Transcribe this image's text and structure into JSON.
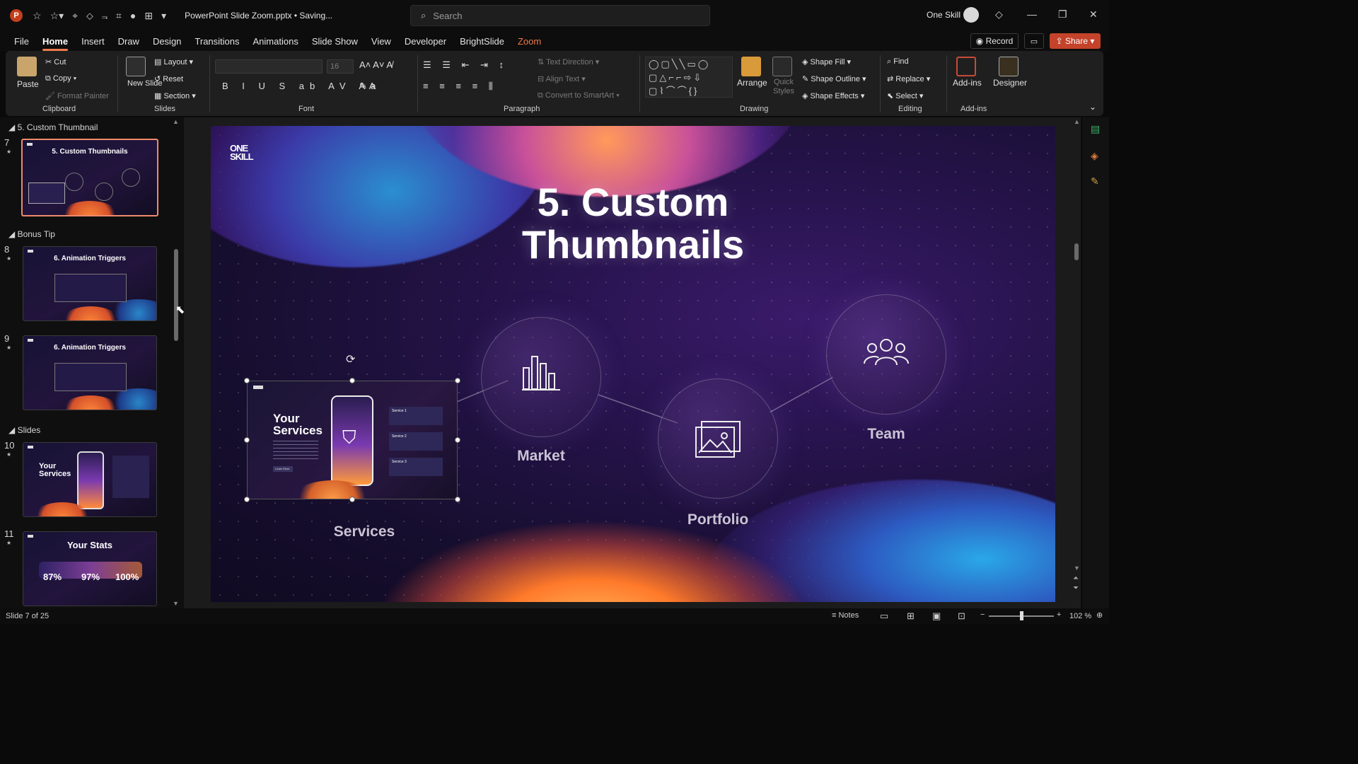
{
  "titlebar": {
    "app_icon": "powerpoint-icon",
    "doc_title": "PowerPoint Slide Zoom.pptx • Saving...",
    "search_placeholder": "Search",
    "user_name": "One Skill"
  },
  "menu": [
    "File",
    "Home",
    "Insert",
    "Draw",
    "Design",
    "Transitions",
    "Animations",
    "Slide Show",
    "View",
    "Developer",
    "BrightSlide",
    "Zoom"
  ],
  "menu_active": "Home",
  "header_buttons": {
    "record": "Record",
    "share": "Share"
  },
  "ribbon": {
    "clipboard": {
      "paste": "Paste",
      "cut": "Cut",
      "copy": "Copy",
      "format_painter": "Format Painter",
      "label": "Clipboard"
    },
    "slides": {
      "new_slide": "New Slide",
      "layout": "Layout",
      "reset": "Reset",
      "section": "Section",
      "label": "Slides"
    },
    "font": {
      "size": "16",
      "label": "Font"
    },
    "paragraph": {
      "text_direction": "Text Direction",
      "align_text": "Align Text",
      "convert_smartart": "Convert to SmartArt",
      "label": "Paragraph"
    },
    "drawing": {
      "arrange": "Arrange",
      "quick_styles": "Quick Styles",
      "shape_fill": "Shape Fill",
      "shape_outline": "Shape Outline",
      "shape_effects": "Shape Effects",
      "label": "Drawing"
    },
    "editing": {
      "find": "Find",
      "replace": "Replace",
      "select": "Select",
      "label": "Editing"
    },
    "addins": {
      "addins": "Add-ins",
      "designer": "Designer",
      "label": "Add-ins"
    }
  },
  "thumbnails": {
    "sections": [
      "5. Custom Thumbnail",
      "Bonus Tip",
      "Slides"
    ],
    "slides": [
      {
        "num": "7",
        "title": "5. Custom Thumbnails"
      },
      {
        "num": "8",
        "title": "6. Animation Triggers"
      },
      {
        "num": "9",
        "title": "6. Animation Triggers"
      },
      {
        "num": "10",
        "title": "Your Services"
      },
      {
        "num": "11",
        "title": "Your Stats",
        "stats": [
          "87%",
          "97%",
          "100%"
        ]
      }
    ]
  },
  "slide": {
    "logo": "ONE SKILL",
    "title_line1": "5. Custom",
    "title_line2": "Thumbnails",
    "nodes": [
      {
        "label": "Services"
      },
      {
        "label": "Market",
        "icon": "bar-chart-icon"
      },
      {
        "label": "Portfolio",
        "icon": "image-icon"
      },
      {
        "label": "Team",
        "icon": "users-icon"
      }
    ],
    "zoom_thumb": {
      "heading_line1": "Your",
      "heading_line2": "Services",
      "services": [
        "Service 1",
        "Service 2",
        "Service 3"
      ],
      "button": "Learn More"
    }
  },
  "status": {
    "slide_counter": "Slide 7 of 25",
    "notes": "Notes",
    "zoom": "102 %"
  }
}
